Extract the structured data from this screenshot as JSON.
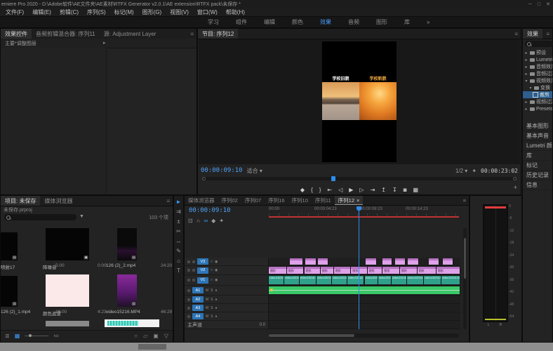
{
  "title_bar": {
    "title": "emiere Pro 2020 - D:\\Adobe软件\\AE文件夹\\AE素材\\RTFX Generator v2.0.1\\AE extension\\RTFX pack\\未保存 *",
    "window_controls": [
      "─",
      "□",
      "✕"
    ]
  },
  "menu_bar": {
    "items": [
      "文件(F)",
      "编辑(E)",
      "剪辑(C)",
      "序列(S)",
      "标记(M)",
      "图形(G)",
      "视图(V)",
      "窗口(W)",
      "帮助(H)"
    ]
  },
  "workspace_tabs": {
    "items": [
      {
        "label": "学习",
        "active": false
      },
      {
        "label": "组件",
        "active": false
      },
      {
        "label": "编辑",
        "active": false
      },
      {
        "label": "颜色",
        "active": false
      },
      {
        "label": "效果",
        "active": true
      },
      {
        "label": "音频",
        "active": false
      },
      {
        "label": "图形",
        "active": false
      },
      {
        "label": "库",
        "active": false
      }
    ],
    "overflow": "»"
  },
  "effect_controls": {
    "tabs": [
      {
        "label": "效果控件",
        "active": true
      },
      {
        "label": "音频剪辑混合器: 序列11",
        "active": false
      },
      {
        "label": "源: Adjustment Layer",
        "active": false
      }
    ],
    "menu_icon": "≡",
    "master_label": "主要*调整图层",
    "expander": "▸"
  },
  "program_monitor": {
    "tab": "节目: 序列12",
    "menu_icon": "≡",
    "timecode": "00:00:09:10",
    "fit": "适合",
    "fit_arrow": "▾",
    "scale": "1/2",
    "scale_arrow": "▾",
    "settings_icon": "✦",
    "duration": "00:00:23:02",
    "video": {
      "left_caption": "学校旧貌",
      "left_caption_color": "#ffffff",
      "right_caption": "学校新貌",
      "right_caption_color": "#f0a843"
    },
    "transport": [
      {
        "name": "add-marker-icon",
        "glyph": "◆"
      },
      {
        "name": "mark-in-icon",
        "glyph": "{"
      },
      {
        "name": "mark-out-icon",
        "glyph": "}"
      },
      {
        "name": "go-to-in-icon",
        "glyph": "⇤"
      },
      {
        "name": "step-back-icon",
        "glyph": "◁"
      },
      {
        "name": "play-icon",
        "glyph": "▶"
      },
      {
        "name": "step-forward-icon",
        "glyph": "▷"
      },
      {
        "name": "go-to-out-icon",
        "glyph": "⇥"
      },
      {
        "name": "lift-icon",
        "glyph": "↥"
      },
      {
        "name": "extract-icon",
        "glyph": "↧"
      },
      {
        "name": "export-frame-icon",
        "glyph": "◙"
      },
      {
        "name": "comparison-view-icon",
        "glyph": "▦"
      }
    ],
    "add_button": "+"
  },
  "effects_panel": {
    "tab": "效果",
    "menu_icon": "≡",
    "tree": [
      {
        "label": "预设",
        "depth": 0,
        "type": "folder",
        "expanded": false,
        "selected": false
      },
      {
        "label": "Lumetri 预设",
        "depth": 0,
        "type": "folder",
        "expanded": false,
        "selected": false
      },
      {
        "label": "音频效果",
        "depth": 0,
        "type": "folder",
        "expanded": false,
        "selected": false
      },
      {
        "label": "音频过渡",
        "depth": 0,
        "type": "folder",
        "expanded": false,
        "selected": false
      },
      {
        "label": "视频效果",
        "depth": 0,
        "type": "folder",
        "expanded": true,
        "selected": false
      },
      {
        "label": "变换",
        "depth": 1,
        "type": "folder",
        "expanded": true,
        "selected": false
      },
      {
        "label": "裁剪",
        "depth": 2,
        "type": "effect",
        "expanded": false,
        "selected": true
      },
      {
        "label": "视频过渡",
        "depth": 0,
        "type": "folder",
        "expanded": false,
        "selected": false
      },
      {
        "label": "Presets",
        "depth": 0,
        "type": "folder",
        "expanded": false,
        "selected": false
      }
    ],
    "stack_tabs": [
      "基本图形",
      "基本声音",
      "Lumetri 颜色",
      "库",
      "标记",
      "历史记录",
      "信息"
    ]
  },
  "project_panel": {
    "tabs": [
      {
        "label": "项目: 未保存",
        "active": true
      },
      {
        "label": "媒体浏览器",
        "active": false
      }
    ],
    "menu_icon": "≡",
    "subtitle": "未保存.prproj",
    "item_count": "103 个项",
    "items": [
      {
        "name": "喷射17",
        "duration": "5:00",
        "kind": "black-wide-cut",
        "badge": "▤"
      },
      {
        "name": "降噪音",
        "duration": "0:00",
        "kind": "black-wide",
        "badge": "▣"
      },
      {
        "name": "126 (2)_2.mp4",
        "duration": "24:20",
        "kind": "dark-tall",
        "badge": "▤"
      },
      {
        "name": "126 (2)_1.mp4",
        "duration": "16:00",
        "kind": "black-wide-cut2",
        "badge": "▤"
      },
      {
        "name": "颜色遮罩",
        "duration": "4:23",
        "kind": "pink-wide",
        "badge": ""
      },
      {
        "name": "video15216.MP4",
        "duration": "46:29",
        "kind": "purple-tall",
        "badge": "▤"
      }
    ],
    "toolbar": {
      "left_icons": [
        {
          "name": "list-view-icon",
          "glyph": "≣"
        },
        {
          "name": "icon-view-icon",
          "glyph": "▦",
          "active": true
        }
      ],
      "sort_icon": "≔",
      "right_icons": [
        {
          "name": "find-icon",
          "glyph": "○"
        },
        {
          "name": "new-bin-icon",
          "glyph": "▱"
        },
        {
          "name": "new-item-icon",
          "glyph": "▣"
        },
        {
          "name": "clear-icon",
          "glyph": "▽"
        }
      ]
    }
  },
  "tools_panel": {
    "tools": [
      {
        "name": "selection-tool",
        "glyph": "►"
      },
      {
        "name": "track-select-tool",
        "glyph": "⇉"
      },
      {
        "name": "ripple-edit-tool",
        "glyph": "±"
      },
      {
        "name": "razor-tool",
        "glyph": "✂"
      },
      {
        "name": "slip-tool",
        "glyph": "↔"
      },
      {
        "name": "pen-tool",
        "glyph": "✎"
      },
      {
        "name": "hand-tool",
        "glyph": "⌂"
      },
      {
        "name": "type-tool",
        "glyph": "T"
      }
    ]
  },
  "timeline": {
    "tabs": [
      {
        "label": "媒体浏览器",
        "active": false
      },
      {
        "label": "序列02",
        "active": false
      },
      {
        "label": "序列07",
        "active": false
      },
      {
        "label": "序列16",
        "active": false
      },
      {
        "label": "序列10",
        "active": false
      },
      {
        "label": "序列11",
        "active": false
      },
      {
        "label": "序列12",
        "active": true
      }
    ],
    "close_icon": "×",
    "menu_icon": "≡",
    "timecode": "00:00:09:10",
    "toolbar_icons": [
      {
        "name": "nest-icon",
        "glyph": "⊡",
        "active": false
      },
      {
        "name": "snap-icon",
        "glyph": "∩",
        "active": false
      },
      {
        "name": "linked-selection-icon",
        "glyph": "∞",
        "active": true
      },
      {
        "name": "add-marker-icon",
        "glyph": "◆",
        "active": false
      },
      {
        "name": "timeline-settings-icon",
        "glyph": "✦",
        "active": false
      }
    ],
    "ruler_labels": [
      {
        "pct": 0,
        "label": "00:00"
      },
      {
        "pct": 24,
        "label": "00:00:04:23"
      },
      {
        "pct": 48,
        "label": "00:00:09:23"
      },
      {
        "pct": 72,
        "label": "00:00:14:23"
      }
    ],
    "video_tracks": [
      "V3",
      "V2",
      "V1"
    ],
    "audio_tracks": [
      "A1",
      "A2",
      "A3",
      "A4"
    ],
    "audio_toggles": [
      "M",
      "S"
    ],
    "master_label": "主声道",
    "master_value": "0.0",
    "v3_clips": [
      {
        "x": 11,
        "w": 7
      },
      {
        "x": 19,
        "w": 6
      },
      {
        "x": 25.5,
        "w": 5.5
      },
      {
        "x": 50.5,
        "w": 6
      },
      {
        "x": 59.5,
        "w": 5
      },
      {
        "x": 66,
        "w": 5.5
      },
      {
        "x": 72.5,
        "w": 6
      },
      {
        "x": 83.5,
        "w": 5.5
      },
      {
        "x": 91,
        "w": 5.5
      }
    ],
    "v2_clips": [
      {
        "x": 0,
        "w": 9.5
      },
      {
        "x": 9.5,
        "w": 9
      },
      {
        "x": 18.5,
        "w": 8.5
      },
      {
        "x": 27,
        "w": 7
      },
      {
        "x": 34,
        "w": 9
      },
      {
        "x": 43,
        "w": 8.5
      },
      {
        "x": 51.5,
        "w": 8
      },
      {
        "x": 59.5,
        "w": 9
      },
      {
        "x": 68.5,
        "w": 9
      },
      {
        "x": 77.5,
        "w": 10
      },
      {
        "x": 87.5,
        "w": 12.5
      }
    ],
    "v2_clip_label": "图形",
    "v1_clips": [
      {
        "x": 0,
        "w": 8
      },
      {
        "x": 8,
        "w": 8
      },
      {
        "x": 16,
        "w": 9
      },
      {
        "x": 25,
        "w": 8
      },
      {
        "x": 33,
        "w": 8
      },
      {
        "x": 41,
        "w": 9
      },
      {
        "x": 50,
        "w": 7
      },
      {
        "x": 57,
        "w": 7
      },
      {
        "x": 64,
        "w": 8
      },
      {
        "x": 72,
        "w": 9
      },
      {
        "x": 81,
        "w": 9
      },
      {
        "x": 90,
        "w": 10
      }
    ],
    "v1_clip_label": "video15216.MP4",
    "a1_clip": {
      "x": 0,
      "w": 100
    }
  },
  "audio_meter": {
    "ticks": [
      "0",
      "-6",
      "-12",
      "-18",
      "-24",
      "-30",
      "-36",
      "-42",
      "-48",
      "-54"
    ],
    "channels": [
      "L",
      "R"
    ]
  }
}
